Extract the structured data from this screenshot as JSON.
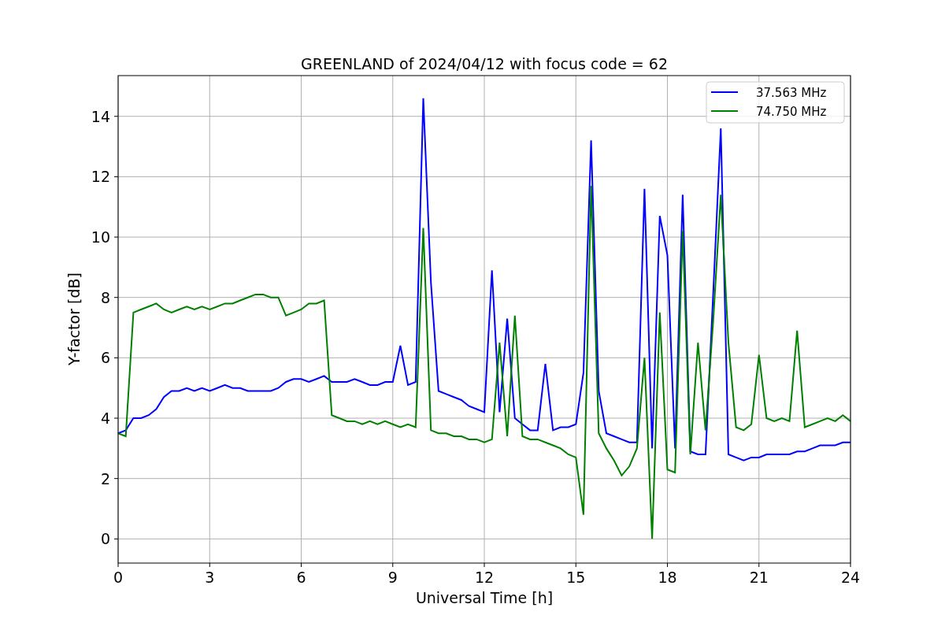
{
  "chart_data": {
    "type": "line",
    "title": "GREENLAND of 2024/04/12 with focus code = 62",
    "xlabel": "Universal Time [h]",
    "ylabel": "Y-factor [dB]",
    "x": [
      0,
      0.25,
      0.5,
      0.75,
      1,
      1.25,
      1.5,
      1.75,
      2,
      2.25,
      2.5,
      2.75,
      3,
      3.25,
      3.5,
      3.75,
      4,
      4.25,
      4.5,
      4.75,
      5,
      5.25,
      5.5,
      5.75,
      6,
      6.25,
      6.5,
      6.75,
      7,
      7.25,
      7.5,
      7.75,
      8,
      8.25,
      8.5,
      8.75,
      9,
      9.25,
      9.5,
      9.75,
      10,
      10.25,
      10.5,
      10.75,
      11,
      11.25,
      11.5,
      11.75,
      12,
      12.25,
      12.5,
      12.75,
      13,
      13.25,
      13.5,
      13.75,
      14,
      14.25,
      14.5,
      14.75,
      15,
      15.25,
      15.5,
      15.75,
      16,
      16.25,
      16.5,
      16.75,
      17,
      17.25,
      17.5,
      17.75,
      18,
      18.25,
      18.5,
      18.75,
      19,
      19.25,
      19.5,
      19.75,
      20,
      20.25,
      20.5,
      20.75,
      21,
      21.25,
      21.5,
      21.75,
      22,
      22.25,
      22.5,
      22.75,
      23,
      23.25,
      23.5,
      23.75,
      24
    ],
    "series": [
      {
        "name": "37.563 MHz",
        "color": "#0000ff",
        "values": [
          3.5,
          3.6,
          4.0,
          4.0,
          4.1,
          4.3,
          4.7,
          4.9,
          4.9,
          5.0,
          4.9,
          5.0,
          4.9,
          5.0,
          5.1,
          5.0,
          5.0,
          4.9,
          4.9,
          4.9,
          4.9,
          5.0,
          5.2,
          5.3,
          5.3,
          5.2,
          5.3,
          5.4,
          5.2,
          5.2,
          5.2,
          5.3,
          5.2,
          5.1,
          5.1,
          5.2,
          5.2,
          6.4,
          5.1,
          5.2,
          14.6,
          8.5,
          4.9,
          4.8,
          4.7,
          4.6,
          4.4,
          4.3,
          4.2,
          8.9,
          4.2,
          7.3,
          4.0,
          3.8,
          3.6,
          3.6,
          5.8,
          3.6,
          3.7,
          3.7,
          3.8,
          5.5,
          13.2,
          4.9,
          3.5,
          3.4,
          3.3,
          3.2,
          3.2,
          11.6,
          3.0,
          10.7,
          9.4,
          3.0,
          11.4,
          2.9,
          2.8,
          2.8,
          8.1,
          13.6,
          2.8,
          2.7,
          2.6,
          2.7,
          2.7,
          2.8,
          2.8,
          2.8,
          2.8,
          2.9,
          2.9,
          3.0,
          3.1,
          3.1,
          3.1,
          3.2,
          3.2
        ]
      },
      {
        "name": "74.750 MHz",
        "color": "#008000",
        "values": [
          3.5,
          3.4,
          7.5,
          7.6,
          7.7,
          7.8,
          7.6,
          7.5,
          7.6,
          7.7,
          7.6,
          7.7,
          7.6,
          7.7,
          7.8,
          7.8,
          7.9,
          8.0,
          8.1,
          8.1,
          8.0,
          8.0,
          7.4,
          7.5,
          7.6,
          7.8,
          7.8,
          7.9,
          4.1,
          4.0,
          3.9,
          3.9,
          3.8,
          3.9,
          3.8,
          3.9,
          3.8,
          3.7,
          3.8,
          3.7,
          10.3,
          3.6,
          3.5,
          3.5,
          3.4,
          3.4,
          3.3,
          3.3,
          3.2,
          3.3,
          6.5,
          3.4,
          7.4,
          3.4,
          3.3,
          3.3,
          3.2,
          3.1,
          3.0,
          2.8,
          2.7,
          0.8,
          11.7,
          3.5,
          3.0,
          2.6,
          2.1,
          2.4,
          3.0,
          6.0,
          0.0,
          7.5,
          2.3,
          2.2,
          10.2,
          2.8,
          6.5,
          3.6,
          7.2,
          11.4,
          6.5,
          3.7,
          3.6,
          3.8,
          6.1,
          4.0,
          3.9,
          4.0,
          3.9,
          6.9,
          3.7,
          3.8,
          3.9,
          4.0,
          3.9,
          4.1,
          3.9
        ]
      }
    ],
    "grid": true,
    "legend": true,
    "xlim": [
      0,
      24
    ],
    "ylim": [
      -0.8,
      15.35
    ],
    "xticks": [
      0,
      3,
      6,
      9,
      12,
      15,
      18,
      21,
      24
    ],
    "yticks": [
      0,
      2,
      4,
      6,
      8,
      10,
      12,
      14
    ]
  }
}
